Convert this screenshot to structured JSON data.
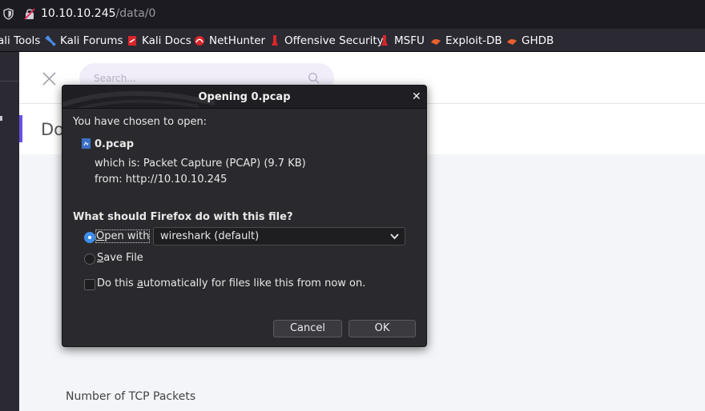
{
  "browser": {
    "url_host": "10.10.10.245",
    "url_path": "/data/0",
    "icons": [
      "shield-icon",
      "insecure-lock-icon"
    ]
  },
  "bookmarks": [
    {
      "label": "ali Tools",
      "icon": "kali-icon"
    },
    {
      "label": "Kali Forums",
      "icon": "kali-forums-icon"
    },
    {
      "label": "Kali Docs",
      "icon": "kali-docs-icon"
    },
    {
      "label": "NetHunter",
      "icon": "nethunter-icon"
    },
    {
      "label": "Offensive Security",
      "icon": "offsec-icon"
    },
    {
      "label": "MSFU",
      "icon": "msfu-icon"
    },
    {
      "label": "Exploit-DB",
      "icon": "exploit-db-icon"
    },
    {
      "label": "GHDB",
      "icon": "ghdb-icon"
    }
  ],
  "page": {
    "search_placeholder": "Search...",
    "title_partial": "Do",
    "tcp_label": "Number of TCP Packets"
  },
  "dialog": {
    "title": "Opening 0.pcap",
    "intro": "You have chosen to open:",
    "file_name": "0.pcap",
    "which_is_label": "which is:",
    "which_is_value": "Packet Capture (PCAP) (9.7 KB)",
    "from_label": "from:",
    "from_value": "http://10.10.10.245",
    "question": "What should Firefox do with this file?",
    "open_with": {
      "pre": "",
      "acc": "O",
      "post": "pen with",
      "selected": true
    },
    "app_select": "wireshark (default)",
    "save_file": {
      "pre": "",
      "acc": "S",
      "post": "ave File",
      "selected": false
    },
    "auto": {
      "pre": "Do this ",
      "acc": "a",
      "post": "utomatically for files like this from now on.",
      "checked": false
    },
    "cancel_label": "Cancel",
    "ok_label": "OK"
  },
  "colors": {
    "accent": "#6a4ee6",
    "radio_on": "#3d8eea",
    "dialog_bg": "#2a2a2e"
  }
}
